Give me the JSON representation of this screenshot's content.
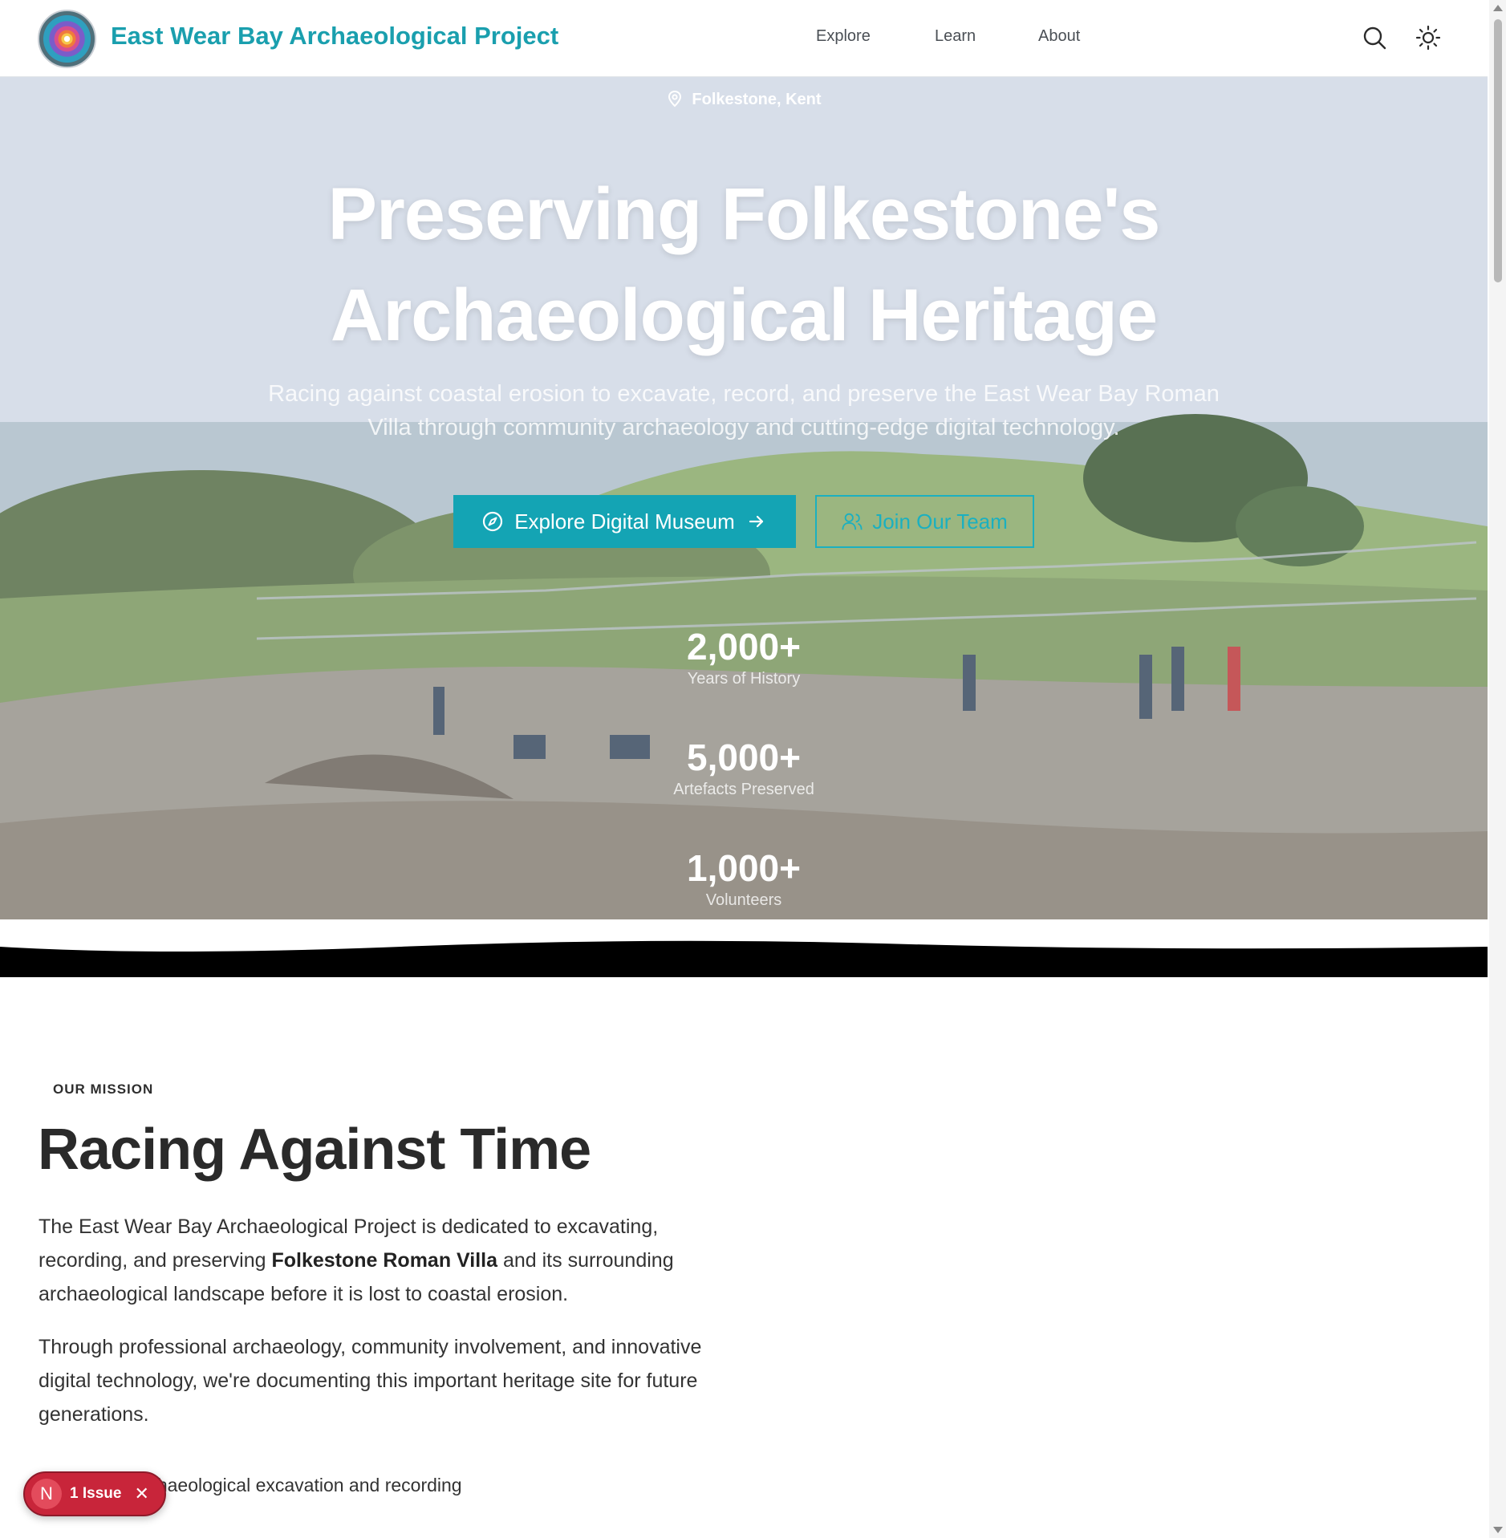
{
  "header": {
    "title": "East Wear Bay Archaeological Project",
    "nav": [
      "Explore",
      "Learn",
      "About"
    ],
    "icons": [
      "search-icon",
      "theme-toggle-icon"
    ]
  },
  "hero": {
    "location": "Folkestone, Kent",
    "title_line1": "Preserving Folkestone's",
    "title_line2": "Archaeological Heritage",
    "subtitle": "Racing against coastal erosion to excavate, record, and preserve the East Wear Bay Roman Villa through community archaeology and cutting-edge digital technology.",
    "primary_button": "Explore Digital Museum",
    "secondary_button": "Join Our Team",
    "stats": [
      {
        "value": "2,000+",
        "label": "Years of History"
      },
      {
        "value": "5,000+",
        "label": "Artefacts Preserved"
      },
      {
        "value": "1,000+",
        "label": "Volunteers"
      }
    ]
  },
  "mission": {
    "eyebrow": "OUR MISSION",
    "title": "Racing Against Time",
    "p1_before": "The East Wear Bay Archaeological Project is dedicated to excavating, recording, and preserving ",
    "p1_strong": "Folkestone Roman Villa",
    "p1_after": " and its surrounding archaeological landscape before it is lost to coastal erosion.",
    "p2": "Through professional archaeology, community involvement, and innovative digital technology, we're documenting this important heritage site for future generations.",
    "bullets": [
      "onal archaeological excavation and recording"
    ]
  },
  "issue_badge": {
    "letter": "N",
    "text": "1 Issue",
    "close": "✕"
  },
  "colors": {
    "brand": "#1a9fae",
    "primary_button": "#14a4b4",
    "issue_badge": "#c8253a"
  }
}
